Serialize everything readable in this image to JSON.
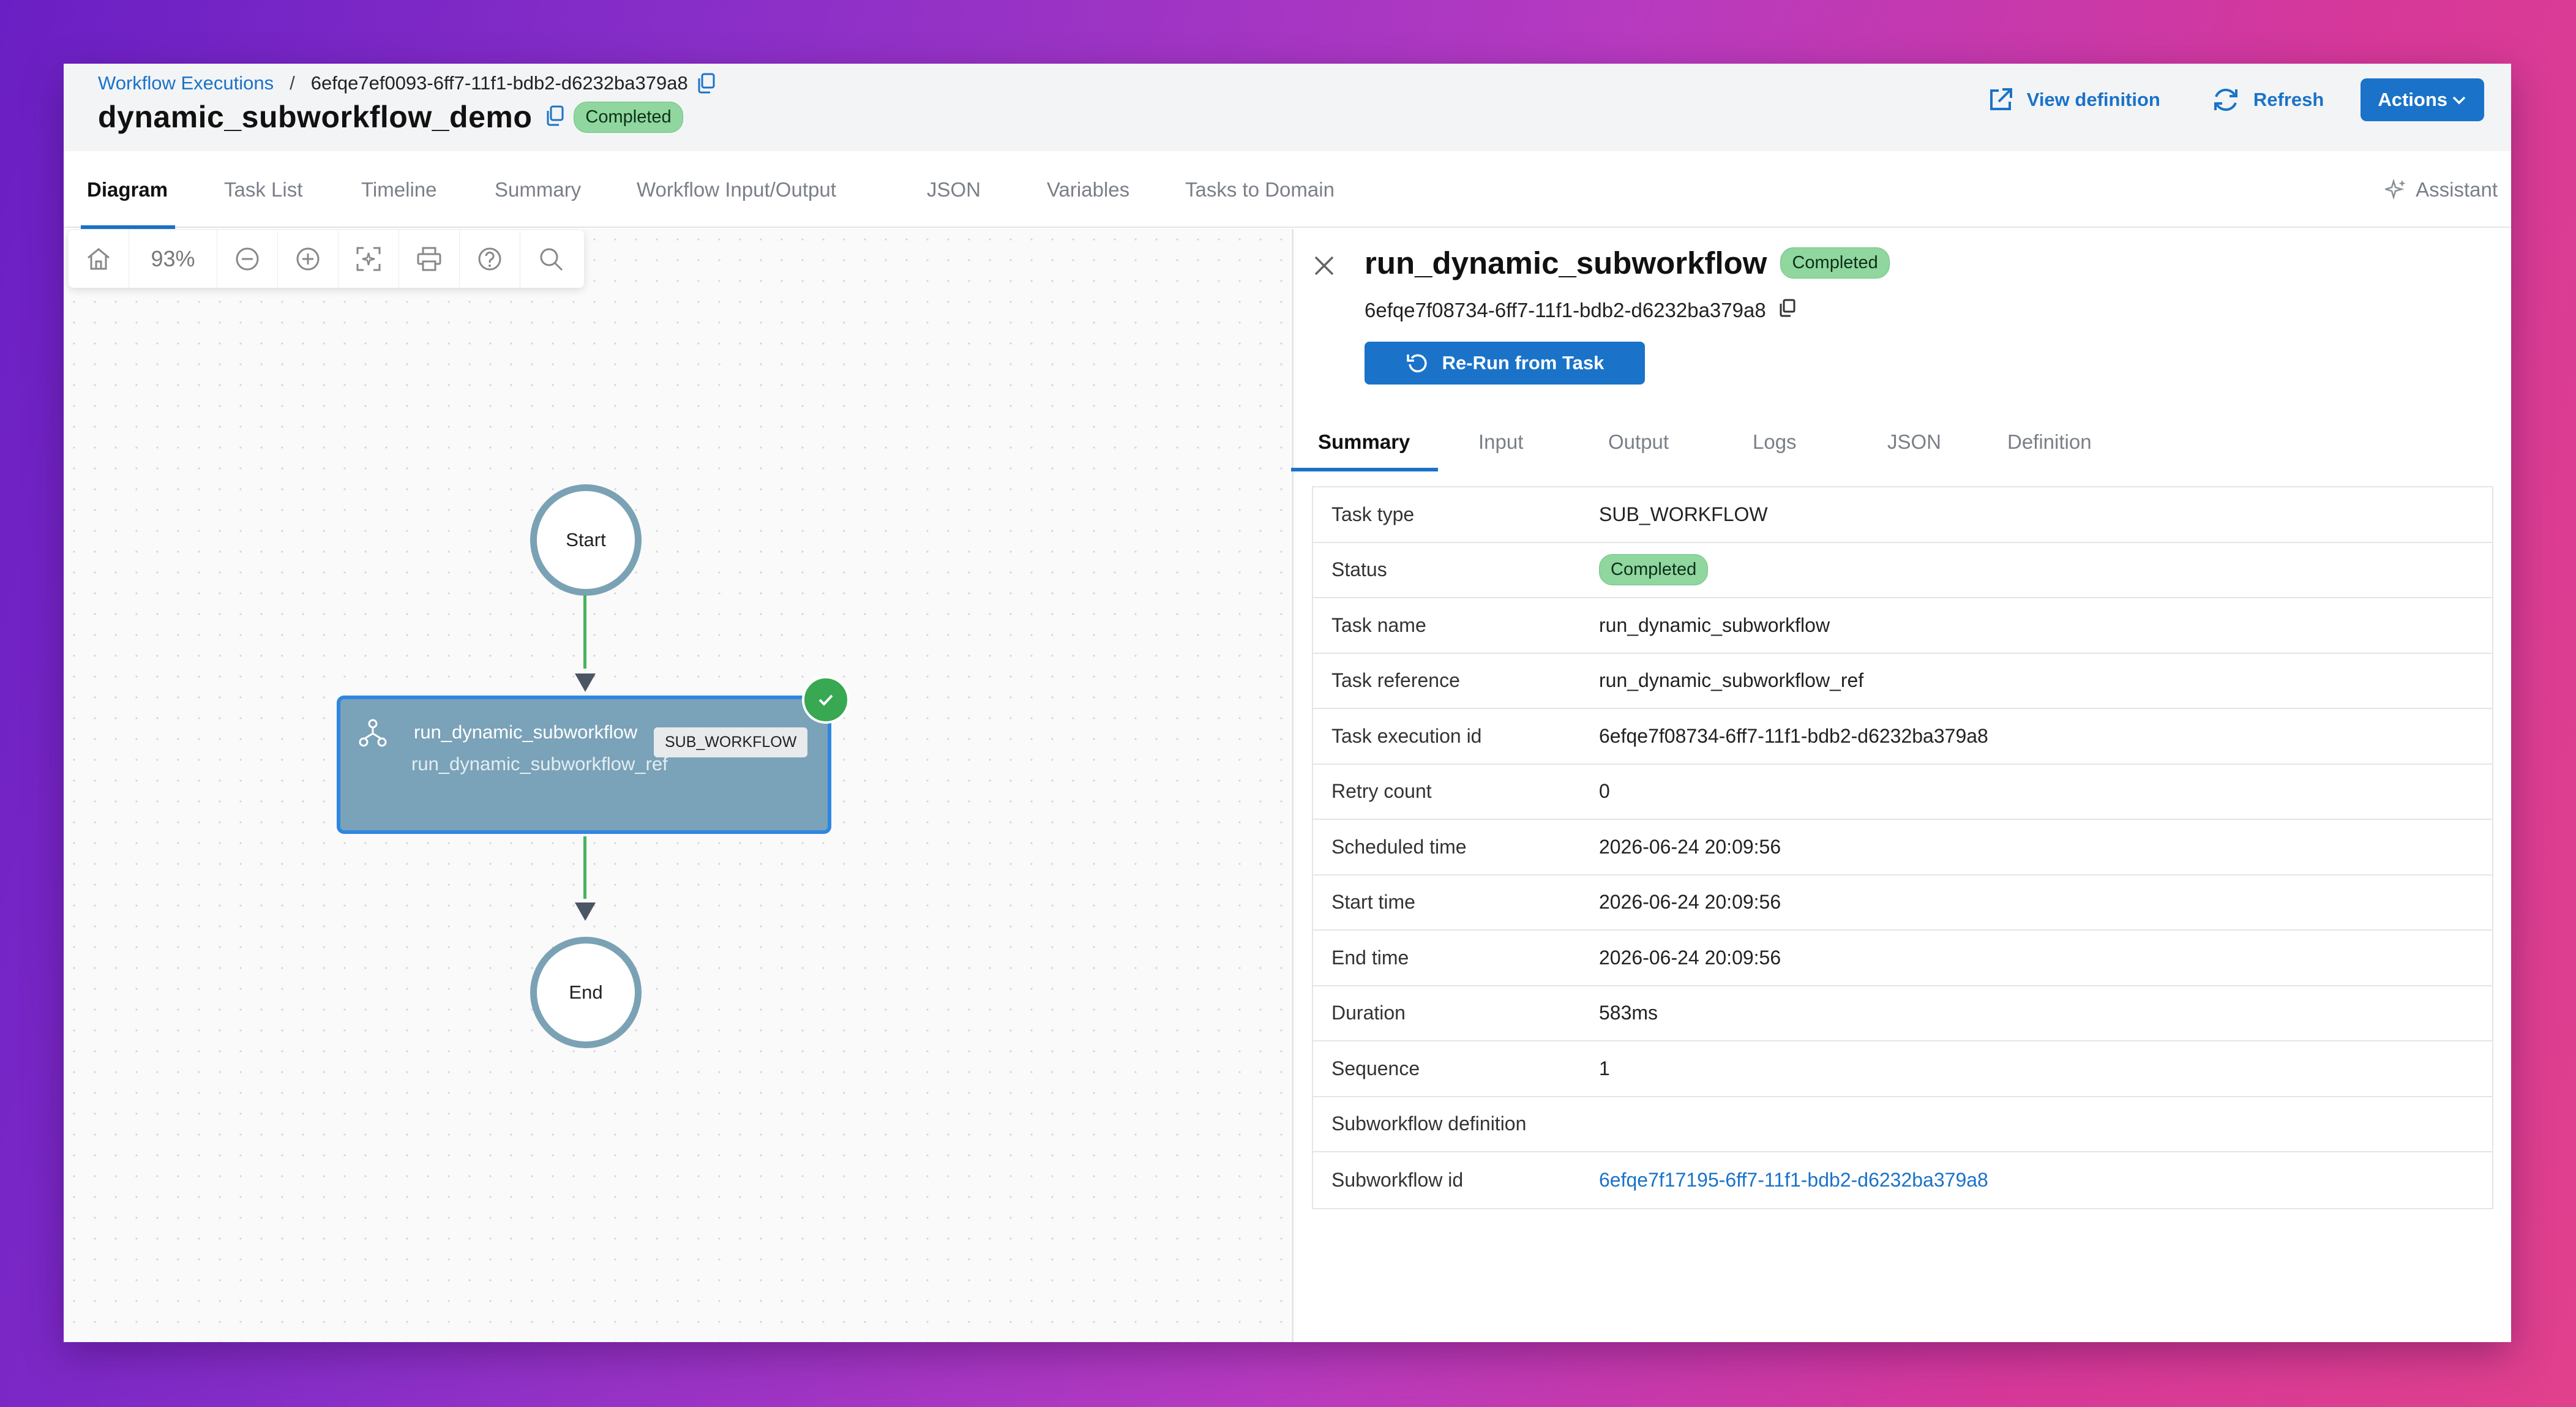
{
  "header": {
    "breadcrumb_link": "Workflow Executions",
    "breadcrumb_sep": "/",
    "breadcrumb_current": "6efqe7ef0093-6ff7-11f1-bdb2-d6232ba379a8",
    "title": "dynamic_subworkflow_demo",
    "status": "Completed",
    "view_definition": "View definition",
    "refresh": "Refresh",
    "actions": "Actions"
  },
  "tabs": [
    "Diagram",
    "Task List",
    "Timeline",
    "Summary",
    "Workflow Input/Output",
    "JSON",
    "Variables",
    "Tasks to Domain"
  ],
  "assistant": "Assistant",
  "toolbar": {
    "zoom": "93%"
  },
  "diagram": {
    "start_label": "Start",
    "end_label": "End",
    "task_name": "run_dynamic_subworkflow",
    "task_ref": "run_dynamic_subworkflow_ref",
    "task_type_tag": "SUB_WORKFLOW"
  },
  "panel": {
    "title": "run_dynamic_subworkflow",
    "status": "Completed",
    "task_id": "6efqe7f08734-6ff7-11f1-bdb2-d6232ba379a8",
    "rerun": "Re-Run from Task",
    "tabs": [
      "Summary",
      "Input",
      "Output",
      "Logs",
      "JSON",
      "Definition"
    ],
    "rows": [
      {
        "key": "Task type",
        "value": "SUB_WORKFLOW"
      },
      {
        "key": "Status",
        "value": "Completed"
      },
      {
        "key": "Task name",
        "value": "run_dynamic_subworkflow"
      },
      {
        "key": "Task reference",
        "value": "run_dynamic_subworkflow_ref"
      },
      {
        "key": "Task execution id",
        "value": "6efqe7f08734-6ff7-11f1-bdb2-d6232ba379a8"
      },
      {
        "key": "Retry count",
        "value": "0"
      },
      {
        "key": "Scheduled time",
        "value": "2026-06-24 20:09:56"
      },
      {
        "key": "Start time",
        "value": "2026-06-24 20:09:56"
      },
      {
        "key": "End time",
        "value": "2026-06-24 20:09:56"
      },
      {
        "key": "Duration",
        "value": "583ms"
      },
      {
        "key": "Sequence",
        "value": "1"
      },
      {
        "key": "Subworkflow definition",
        "value": ""
      },
      {
        "key": "Subworkflow id",
        "value": "6efqe7f17195-6ff7-11f1-bdb2-d6232ba379a8"
      }
    ]
  },
  "colors": {
    "accent": "#1a73c8",
    "success": "#38a852",
    "badge_bg": "#8fd69f",
    "node_bg": "#7aa2b8"
  }
}
